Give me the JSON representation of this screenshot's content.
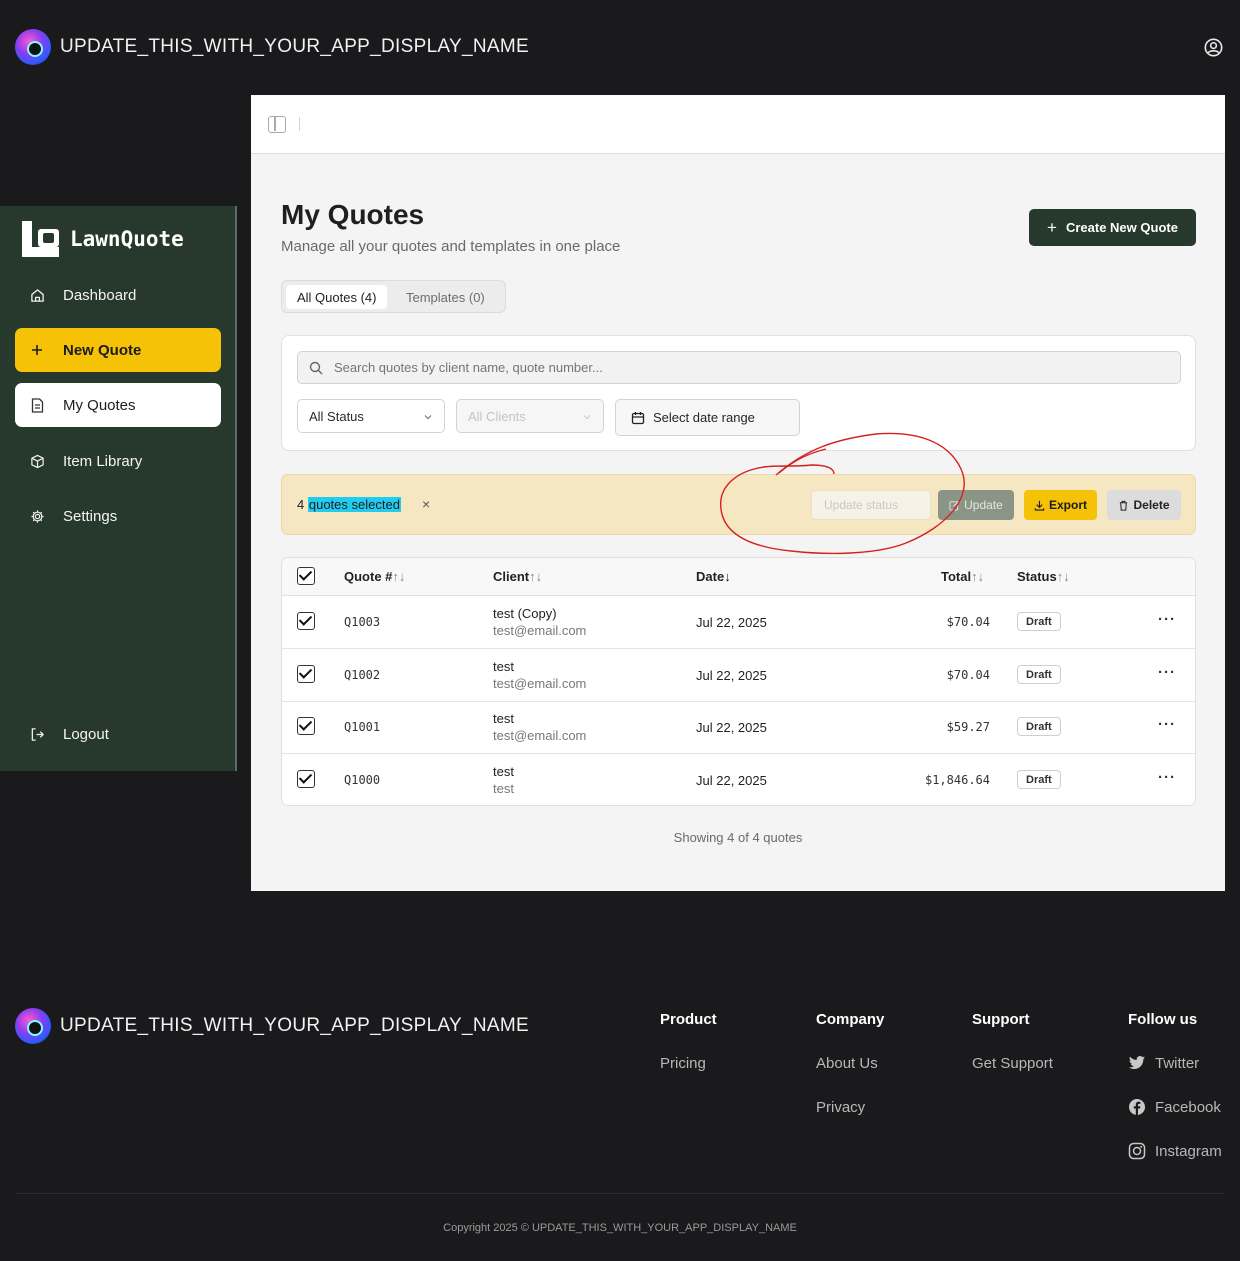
{
  "app": {
    "display_name": "UPDATE_THIS_WITH_YOUR_APP_DISPLAY_NAME"
  },
  "sidebar": {
    "brand": "LawnQuote",
    "items": [
      {
        "label": "Dashboard",
        "icon": "home-icon"
      },
      {
        "label": "New Quote",
        "icon": "plus-icon"
      },
      {
        "label": "My Quotes",
        "icon": "document-icon"
      },
      {
        "label": "Item Library",
        "icon": "box-icon"
      },
      {
        "label": "Settings",
        "icon": "gear-icon"
      }
    ],
    "logout": "Logout"
  },
  "page": {
    "title": "My Quotes",
    "subtitle": "Manage all your quotes and templates in one place",
    "create_button": "Create New Quote",
    "tabs": [
      "All Quotes (4)",
      "Templates (0)"
    ]
  },
  "filters": {
    "search_placeholder": "Search quotes by client name, quote number...",
    "status": "All Status",
    "clients": "All Clients",
    "date_range": "Select date range"
  },
  "bulk": {
    "count": "4",
    "selected_text": "quotes selected",
    "close": "×",
    "status_placeholder": "Update status",
    "update": "Update",
    "export": "Export",
    "delete": "Delete"
  },
  "table": {
    "columns": [
      "Quote #",
      "Client",
      "Date",
      "Total",
      "Status"
    ],
    "sort_both": "↑↓",
    "sort_down": "↓",
    "rows": [
      {
        "number": "Q1003",
        "client": "test (Copy)",
        "email": "test@email.com",
        "date": "Jul 22, 2025",
        "total": "$70.04",
        "status": "Draft"
      },
      {
        "number": "Q1002",
        "client": "test",
        "email": "test@email.com",
        "date": "Jul 22, 2025",
        "total": "$70.04",
        "status": "Draft"
      },
      {
        "number": "Q1001",
        "client": "test",
        "email": "test@email.com",
        "date": "Jul 22, 2025",
        "total": "$59.27",
        "status": "Draft"
      },
      {
        "number": "Q1000",
        "client": "test",
        "email": "test",
        "date": "Jul 22, 2025",
        "total": "$1,846.64",
        "status": "Draft"
      }
    ],
    "more": "···"
  },
  "showing": "Showing 4 of 4 quotes",
  "footer": {
    "columns": [
      {
        "title": "Product",
        "links": [
          "Pricing"
        ]
      },
      {
        "title": "Company",
        "links": [
          "About Us",
          "Privacy"
        ]
      },
      {
        "title": "Support",
        "links": [
          "Get Support"
        ]
      },
      {
        "title": "Follow us",
        "links": [
          "Twitter",
          "Facebook",
          "Instagram"
        ]
      }
    ],
    "copyright": "Copyright 2025 © UPDATE_THIS_WITH_YOUR_APP_DISPLAY_NAME"
  },
  "colors": {
    "sidebar_bg": "#27392c",
    "accent_yellow": "#f5c208",
    "bulk_bg": "#f6e7c3",
    "annotation_red": "#d62020"
  }
}
